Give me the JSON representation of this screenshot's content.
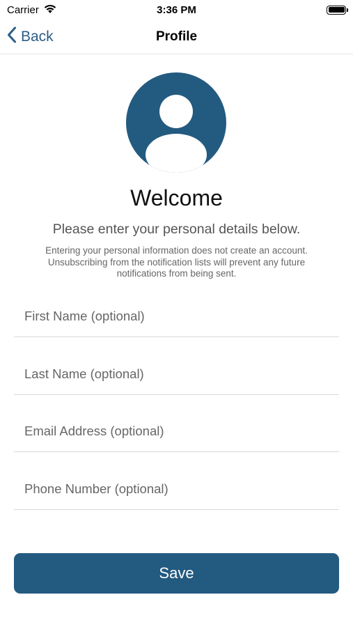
{
  "status_bar": {
    "carrier": "Carrier",
    "time": "3:36 PM"
  },
  "nav": {
    "back_label": "Back",
    "title": "Profile"
  },
  "header": {
    "welcome": "Welcome",
    "subtitle": "Please enter your personal details below.",
    "disclaimer_lines": [
      "Entering your personal information does not create an account.",
      "Unsubscribing from the notification lists will prevent any future",
      "notifications from being sent."
    ]
  },
  "form": {
    "first_name_placeholder": "First Name (optional)",
    "last_name_placeholder": "Last Name (optional)",
    "email_placeholder": "Email Address (optional)",
    "phone_placeholder": "Phone Number (optional)"
  },
  "actions": {
    "save_label": "Save"
  },
  "colors": {
    "accent": "#235a80",
    "back_link": "#2b5d86"
  },
  "icons": {
    "back": "chevron-left-icon",
    "avatar": "person-icon",
    "wifi": "wifi-icon",
    "battery": "battery-icon"
  }
}
